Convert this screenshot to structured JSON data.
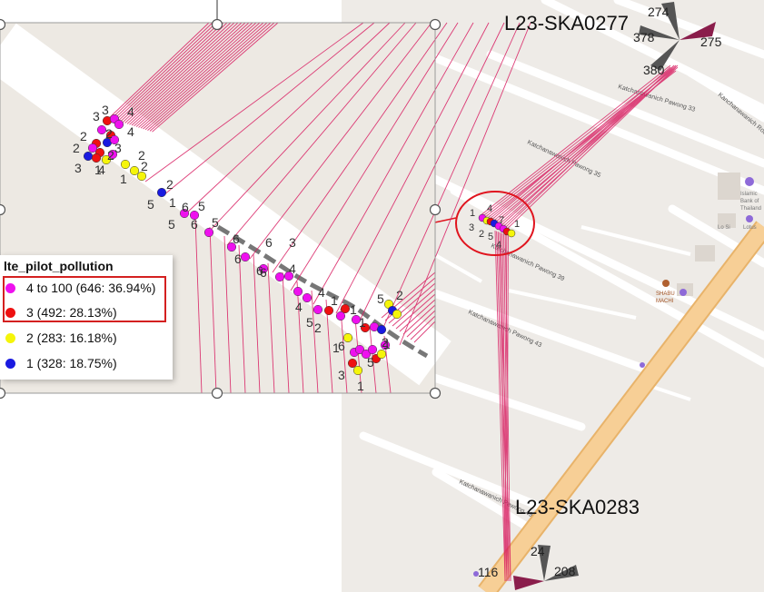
{
  "sites": {
    "top": {
      "name": "L23-SKA0277",
      "sectors": [
        "274",
        "378",
        "380",
        "275"
      ]
    },
    "bottom": {
      "name": "L23-SKA0283",
      "sectors": [
        "24",
        "116",
        "208"
      ]
    }
  },
  "legend": {
    "title": "lte_pilot_pollution",
    "items": [
      {
        "label": "4 to 100 (646: 36.94%)",
        "color": "#ee11ee"
      },
      {
        "label": "3 (492: 28.13%)",
        "color": "#ee1111"
      },
      {
        "label": "2 (283: 16.18%)",
        "color": "#f5f50a"
      },
      {
        "label": "1 (328: 18.75%)",
        "color": "#1a1ae0"
      }
    ]
  },
  "map_labels": {
    "streets": [
      "Katchanawanich Pawong 33",
      "Katchanawanich Pawong 35",
      "Katchanawanich Pawong 39",
      "Katchanawanich Pawong 43",
      "Katchanawanich Pawong 49",
      "Kanchanawanich Road"
    ],
    "pois": [
      "Islamic Bank of Thailand",
      "SHABU MACHI",
      "Lo Si",
      "Lotus"
    ]
  },
  "small_cluster_labels": [
    "1",
    "4",
    "7",
    "1",
    "3",
    "2",
    "5",
    "4"
  ],
  "zoom_labels": [
    "3",
    "4",
    "3",
    "4",
    "2",
    "2",
    "2",
    "3",
    "4",
    "2",
    "3",
    "1",
    "2",
    "1",
    "2",
    "2",
    "5",
    "1",
    "6",
    "5",
    "5",
    "6",
    "5",
    "6",
    "6",
    "6",
    "6",
    "4",
    "3",
    "6",
    "4",
    "4",
    "5",
    "1",
    "1",
    "1",
    "5",
    "2",
    "1",
    "6",
    "5",
    "2",
    "3",
    "2",
    "1",
    "1"
  ],
  "colors": {
    "ray": "#d81b60",
    "map_bg": "#eeebe7",
    "road": "#f7c88a",
    "zoom_bg": "#ede9e3"
  }
}
